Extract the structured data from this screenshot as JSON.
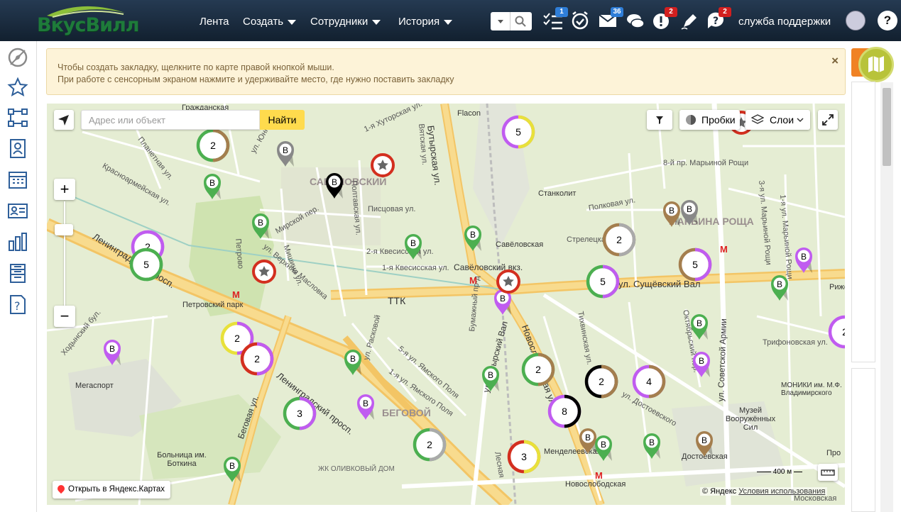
{
  "brand": {
    "logo_text": "ВкусВилл"
  },
  "nav": [
    {
      "label": "Лента",
      "has_menu": false
    },
    {
      "label": "Создать",
      "has_menu": true
    },
    {
      "label": "Сотрудники",
      "has_menu": true
    },
    {
      "label": "История",
      "has_menu": true
    }
  ],
  "header_icons": {
    "tasks_badge": "1",
    "mail_badge": "36",
    "alerts_badge": "2",
    "questions_badge": "2",
    "badge_color_blue": "#2f7ed8",
    "badge_color_red": "#d21f1f"
  },
  "user": {
    "name": "служба поддержки"
  },
  "sidebar": [
    "compass-off-icon",
    "star-icon",
    "structure-icon",
    "contact-card-icon",
    "calendar-icon",
    "id-card-icon",
    "bar-chart-icon",
    "list-icon",
    "help-document-icon"
  ],
  "notice": {
    "line1": "Чтобы создать закладку, щелкните по карте правой кнопкой мыши.",
    "line2": "При работе с сенсорным экраном нажмите и удерживайте место, где нужно поставить закладку",
    "close": "×"
  },
  "map": {
    "search_placeholder": "Адрес или объект",
    "search_button": "Найти",
    "traffic_label": "Пробки",
    "layers_label": "Слои",
    "open_in_maps": "Открыть в Яндекс.Картах",
    "copyright_prefix": "© Яндекс",
    "terms": "Условия использования",
    "scale_label": "400 м",
    "zoom_in": "+",
    "zoom_out": "−"
  },
  "map_labels": {
    "district1": "САВЁЛОВСКИЙ",
    "district2": "МАРЬИНА РОЩА",
    "district3": "БЕГОВОЙ",
    "ttk": "ТТК",
    "station": "Савёловская",
    "station2": "Савёловский вкз.",
    "stankolit": "Станколит",
    "petrovsky": "Петровский парк",
    "butyrskaya": "Бутырская ул.",
    "leningradsky": "Ленинградский просп.",
    "leningradsky2": "Ленинградский просп.",
    "sushchevsky": "ул. Сущёвский Вал",
    "novoslobodskaya": "Новослободская",
    "mendeleevskaya": "Менделеевская",
    "dostoevskaya": "Достоевская",
    "megasport": "Мегаспорт",
    "botkina": "Больница им. Боткина",
    "olivkovy": "ЖК ОЛИВКОВЫЙ ДОМ",
    "museum": "Музей Вооружённых Сил",
    "monikiy": "МОНИКИ им. М.Ф. Владимирского",
    "begovaya": "Беговая ул.",
    "flacon": "Flacon",
    "grazhdanskaya": "Гражданская",
    "planetnaya": "Планетная ул.",
    "krasnoarmeyskaya": "Красноармейская ул.",
    "yunnatov": "ул. Юннатов",
    "verkhnyaya_maslovka": "ул. Верхняя Масловка",
    "pistsovaya": "Писцовая ул.",
    "kvesisskaya1": "1-я Квесисская ул.",
    "kvesisskaya2": "2-я Квесисская ул.",
    "poltavskaya": "Полтавская ул.",
    "mirskoy": "Мирской пер.",
    "mishina": "Мишина ул.",
    "petrovsko": "Петрово",
    "polkovaya": "Полковая ул.",
    "streletskaya": "Стрелецкая",
    "trifonovskaya": "Трифоновская ул.",
    "sovetskoy_armii": "ул. Советской Армии",
    "oktyabrsky": "Октябрьский пер.",
    "dostoevskogo": "ул. Достоевского",
    "tikhvinskaya": "Тихвинская ул.",
    "bumazhny": "Бумажный пр-д",
    "yamskoe": "5-я ул. Ямского Поля",
    "yamskoe1": "1-я ул. Ямского Поля",
    "rasskovaya": "ул. Расковой",
    "khodynsky": "Ходынский бул.",
    "marinoy1": "8-й пр. Марьиной Рощи",
    "marinoy2": "3-я ул. Марьиной Рощи",
    "marinoy3": "1-я ул. Марьиной Рощи",
    "khutorskaya": "1-я Хуторская ул.",
    "vyatskaya": "Вятская ул.",
    "novoslobodskaya_st": "Новослободская ул.",
    "lesnaya": "Лесная",
    "moskovskaya": "Московская",
    "ul_butyrskiy": "ул. Бутырский Вал",
    "zhivopisnaya": "Рижская",
    "prospekt": "Про",
    "leningradsky3": "Ленинградский просп."
  },
  "clusters": [
    {
      "count": "2",
      "colors": [
        "#4caf50",
        "#a47e4e"
      ]
    },
    {
      "count": "5",
      "colors": [
        "#c05cf0",
        "#e8e13a"
      ]
    },
    {
      "count": "2",
      "colors": [
        "#c05cf0",
        "#c05cf0"
      ]
    },
    {
      "count": "5",
      "colors": [
        "#4caf50",
        "#4caf50"
      ]
    },
    {
      "count": "2",
      "colors": [
        "#e8e13a",
        "#c05cf0"
      ]
    },
    {
      "count": "2",
      "colors": [
        "#d32f1f",
        "#c05cf0"
      ]
    },
    {
      "count": "3",
      "colors": [
        "#4caf50",
        "#c05cf0"
      ]
    },
    {
      "count": "2",
      "colors": [
        "#a47e4e",
        "#aaaaaa"
      ]
    },
    {
      "count": "5",
      "colors": [
        "#4caf50",
        "#c05cf0"
      ]
    },
    {
      "count": "5",
      "colors": [
        "#a47e4e",
        "#c05cf0"
      ]
    },
    {
      "count": "2",
      "colors": [
        "#4caf50",
        "#a47e4e"
      ]
    },
    {
      "count": "2",
      "colors": [
        "#000000",
        "#a47e4e"
      ]
    },
    {
      "count": "4",
      "colors": [
        "#c05cf0",
        "#a47e4e"
      ]
    },
    {
      "count": "8",
      "colors": [
        "#c05cf0",
        "#000000"
      ]
    },
    {
      "count": "3",
      "colors": [
        "#d32f1f",
        "#e8e13a"
      ]
    },
    {
      "count": "2",
      "colors": [
        "#4caf50",
        "#aaaaaa"
      ]
    },
    {
      "count": "2",
      "colors": [
        "#c05cf0",
        "#a47e4e"
      ]
    }
  ],
  "pin_label": "В"
}
